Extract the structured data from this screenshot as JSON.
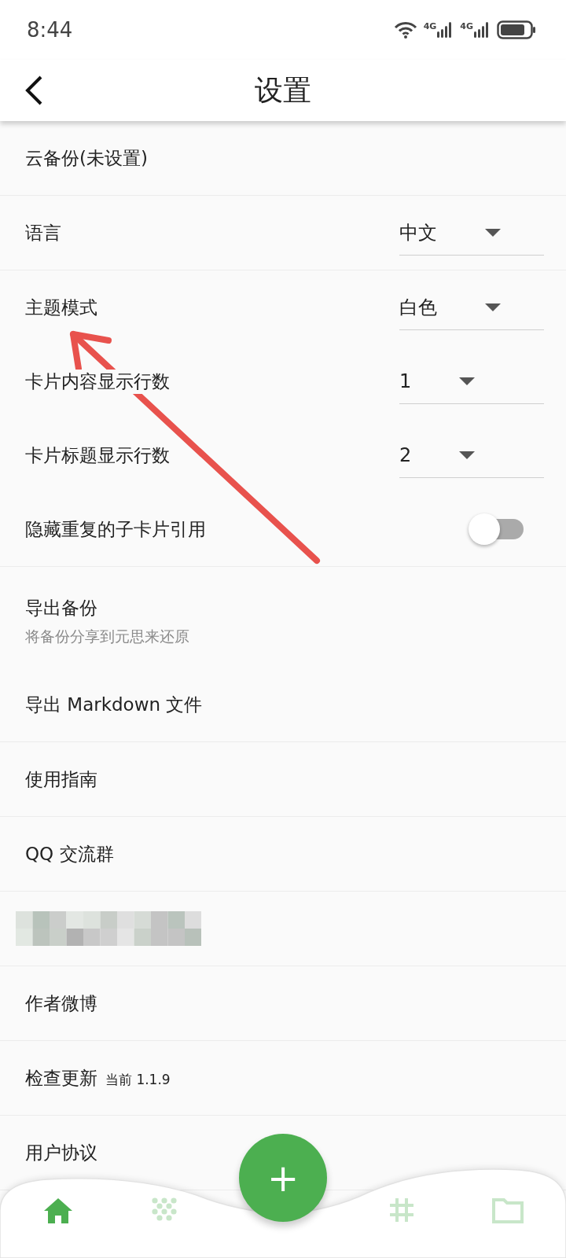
{
  "status_bar": {
    "time": "8:44",
    "networks": [
      {
        "label": "4G"
      },
      {
        "label": "4G"
      }
    ]
  },
  "app_bar": {
    "title": "设置"
  },
  "sections": [
    {
      "items": [
        {
          "kind": "link",
          "label": "云备份(未设置)"
        }
      ]
    },
    {
      "items": [
        {
          "kind": "dropdown",
          "label": "语言",
          "value": "中文"
        }
      ]
    },
    {
      "items": [
        {
          "kind": "dropdown",
          "label": "主题模式",
          "value": "白色"
        },
        {
          "kind": "dropdown",
          "label": "卡片内容显示行数",
          "value": "1"
        },
        {
          "kind": "dropdown",
          "label": "卡片标题显示行数",
          "value": "2"
        },
        {
          "kind": "toggle",
          "label": "隐藏重复的子卡片引用",
          "on": false
        }
      ]
    },
    {
      "items": [
        {
          "kind": "subtitle",
          "label": "导出备份",
          "subtitle": "将备份分享到元思来还原"
        },
        {
          "kind": "link",
          "label": "导出 Markdown 文件"
        }
      ]
    },
    {
      "items": [
        {
          "kind": "link",
          "label": "使用指南"
        }
      ]
    },
    {
      "items": [
        {
          "kind": "link",
          "label": "QQ 交流群"
        }
      ]
    },
    {
      "items": [
        {
          "kind": "redacted"
        }
      ]
    },
    {
      "items": [
        {
          "kind": "link",
          "label": "作者微博"
        }
      ]
    },
    {
      "items": [
        {
          "kind": "version",
          "label": "检查更新",
          "note": "当前 1.1.9"
        }
      ]
    },
    {
      "items": [
        {
          "kind": "link",
          "label": "用户协议"
        }
      ]
    }
  ],
  "bottom_nav": {
    "items": [
      {
        "selected": true
      },
      {
        "selected": false
      },
      {
        "selected": false
      },
      {
        "selected": false
      }
    ],
    "fab": {
      "label": "+"
    }
  }
}
